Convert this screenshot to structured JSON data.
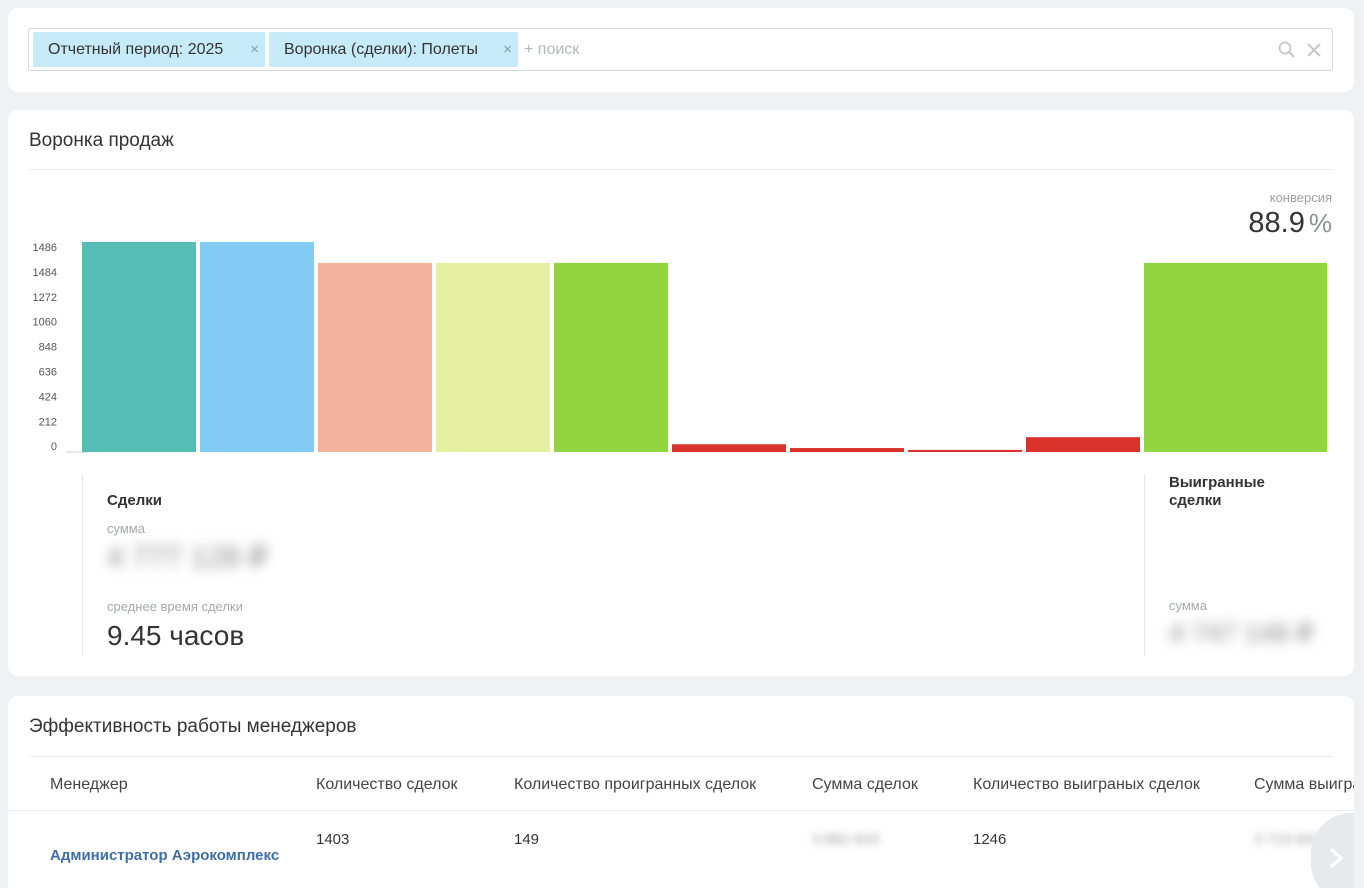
{
  "filter": {
    "chips": [
      {
        "label": "Отчетный период: 2025"
      },
      {
        "label": "Воронка (сделки): Полеты"
      }
    ],
    "search_placeholder": "+ поиск",
    "remove_glyph": "×",
    "clear_glyph": "✕"
  },
  "funnel": {
    "title": "Воронка продаж",
    "conversion_label": "конверсия",
    "conversion_value": "88.9",
    "conversion_unit": "%",
    "deals": {
      "heading": "Сделки",
      "sum_label": "сумма",
      "sum_value": "4 777 128 ₽",
      "avg_time_label": "среднее время сделки",
      "avg_time_value": "9.45 часов"
    },
    "won": {
      "heading": "Выигранные сделки",
      "sum_label": "сумма",
      "sum_value": "4 747 148 ₽"
    }
  },
  "chart_data": {
    "type": "bar",
    "yticks": [
      "1486",
      "1484",
      "1272",
      "1060",
      "848",
      "636",
      "424",
      "212",
      "0"
    ],
    "ylim": [
      0,
      1484
    ],
    "values": [
      1486,
      1486,
      1338,
      1338,
      1338,
      55,
      28,
      15,
      105
    ],
    "colors": [
      "#56bdb6",
      "#82cbf5",
      "#f3b29d",
      "#e5f1a0",
      "#92d541",
      "#d9332b",
      "#d9332b",
      "#d9332b",
      "#d9332b"
    ],
    "won_value": 1338,
    "won_color": "#92d541"
  },
  "managers": {
    "title": "Эффективность работы менеджеров",
    "columns": [
      "Менеджер",
      "Количество сделок",
      "Количество проигранных сделок",
      "Сумма сделок",
      "Количество выиграных сделок",
      "Сумма выигра"
    ],
    "rows": [
      {
        "name": "Администратор Аэрокомплекс",
        "deals": "1403",
        "lost": "149",
        "sum": "3 882 643",
        "won": "1246",
        "won_sum": "3 719 842"
      }
    ],
    "next_glyph": "›"
  }
}
